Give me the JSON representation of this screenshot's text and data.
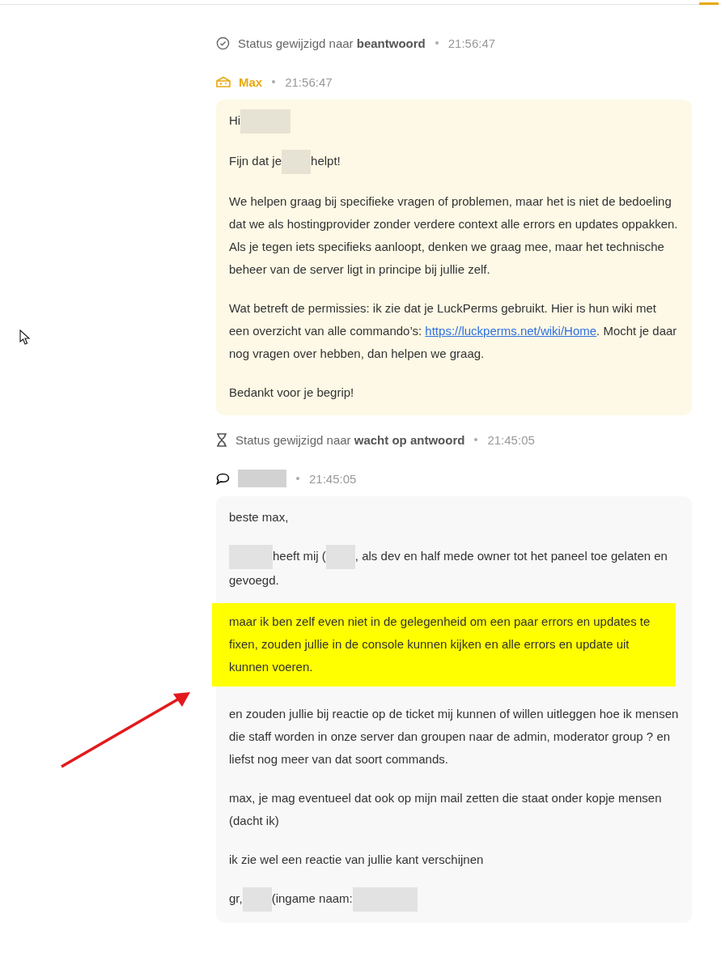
{
  "events": [
    {
      "kind": "status",
      "text": "Status gewijzigd naar **beantwoord**",
      "time": "21:56:47"
    },
    {
      "kind": "message",
      "author": [
        {
          "kind": "text",
          "text": "Max"
        }
      ],
      "time": "21:56:47",
      "paragraphs": [
        {
          "highlighted": false,
          "segments": [
            {
              "kind": "text",
              "text": "Hi"
            },
            {
              "kind": "redacted"
            }
          ]
        },
        {
          "highlighted": false,
          "segments": [
            {
              "kind": "text",
              "text": "Fijn dat je"
            },
            {
              "kind": "redacted"
            },
            {
              "kind": "text",
              "text": "helpt!"
            }
          ]
        },
        {
          "highlighted": false,
          "segments": [
            {
              "kind": "text",
              "text": "We helpen graag bij specifieke vragen of problemen, maar het is niet de bedoeling dat we als hostingprovider zonder verdere context alle errors en updates oppakken. Als je tegen iets specifieks aanloopt, denken we graag mee, maar het technische beheer van de server ligt in principe bij jullie zelf."
            }
          ]
        },
        {
          "highlighted": false,
          "segments": [
            {
              "kind": "text",
              "text": "Wat betreft de permissies: ik zie dat je LuckPerms gebruikt. Hier is hun wiki met een overzicht van alle commando’s: "
            },
            {
              "kind": "link",
              "text": "https://luckperms.net/wiki/Home"
            },
            {
              "kind": "text",
              "text": ". Mocht je daar nog vragen over hebben, dan helpen we graag."
            }
          ]
        },
        {
          "highlighted": false,
          "segments": [
            {
              "kind": "text",
              "text": "Bedankt voor je begrip!"
            }
          ]
        }
      ]
    },
    {
      "kind": "status",
      "text": "Status gewijzigd naar **wacht op antwoord**",
      "time": "21:45:05"
    },
    {
      "kind": "message",
      "author": [
        {
          "kind": "redacted"
        }
      ],
      "time": "21:45:05",
      "paragraphs": [
        {
          "highlighted": false,
          "segments": [
            {
              "kind": "text",
              "text": "beste max,"
            }
          ]
        },
        {
          "highlighted": false,
          "segments": [
            {
              "kind": "redacted"
            },
            {
              "kind": "text",
              "text": "heeft mij ("
            },
            {
              "kind": "redacted"
            },
            {
              "kind": "text",
              "text": ", als dev en half mede owner tot het paneel toe gelaten en gevoegd."
            }
          ]
        },
        {
          "highlighted": true,
          "segments": [
            {
              "kind": "text",
              "text": "maar ik ben zelf even niet in de gelegenheid om een paar errors en updates te fixen, zouden jullie in de console kunnen kijken en alle errors en update uit kunnen voeren."
            }
          ]
        },
        {
          "highlighted": false,
          "segments": [
            {
              "kind": "text",
              "text": "en zouden jullie bij reactie op de ticket mij kunnen of willen uitleggen hoe ik mensen die staff worden in onze server dan groupen naar de admin, moderator group ? en liefst nog meer van dat soort commands."
            }
          ]
        },
        {
          "highlighted": false,
          "segments": [
            {
              "kind": "text",
              "text": "max, je mag eventueel dat ook op mijn mail zetten die staat onder kopje mensen (dacht ik)"
            }
          ]
        },
        {
          "highlighted": false,
          "segments": [
            {
              "kind": "text",
              "text": "ik zie wel een reactie van jullie kant verschijnen"
            }
          ]
        },
        {
          "highlighted": false,
          "segments": [
            {
              "kind": "text",
              "text": "gr,"
            },
            {
              "kind": "redacted"
            },
            {
              "kind": "text",
              "text": "(ingame naam:"
            },
            {
              "kind": "redacted"
            }
          ]
        }
      ]
    }
  ]
}
